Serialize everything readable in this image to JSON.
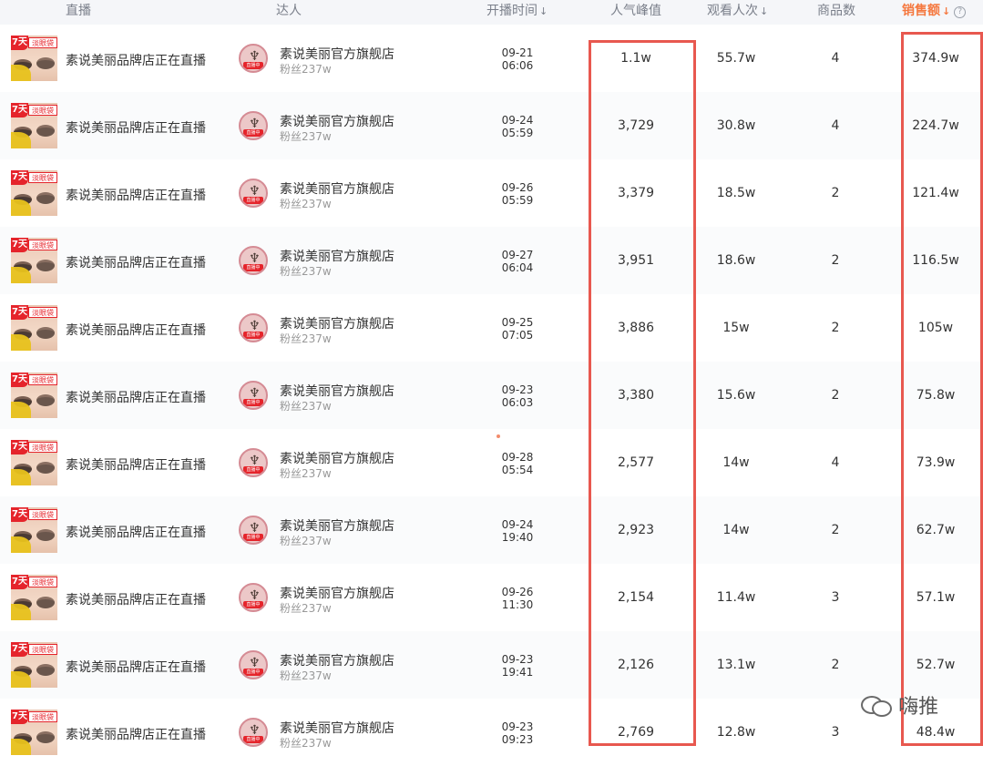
{
  "header": {
    "live": "直播",
    "anchor": "达人",
    "start_time": "开播时间",
    "peak": "人气峰值",
    "views": "观看人次",
    "goods": "商品数",
    "sales": "销售额",
    "sort_arrow": "↓",
    "help": "?"
  },
  "thumb": {
    "badge_day": "7天",
    "badge_text": "淡眼袋"
  },
  "avatar": {
    "crane": "♆",
    "live_tag": "直播中"
  },
  "rows": [
    {
      "title": "素说美丽品牌店正在直播",
      "anchor": "素说美丽官方旗舰店",
      "fans": "粉丝237w",
      "date": "09-21",
      "time": "06:06",
      "peak": "1.1w",
      "views": "55.7w",
      "goods": "4",
      "sales": "374.9w"
    },
    {
      "title": "素说美丽品牌店正在直播",
      "anchor": "素说美丽官方旗舰店",
      "fans": "粉丝237w",
      "date": "09-24",
      "time": "05:59",
      "peak": "3,729",
      "views": "30.8w",
      "goods": "4",
      "sales": "224.7w"
    },
    {
      "title": "素说美丽品牌店正在直播",
      "anchor": "素说美丽官方旗舰店",
      "fans": "粉丝237w",
      "date": "09-26",
      "time": "05:59",
      "peak": "3,379",
      "views": "18.5w",
      "goods": "2",
      "sales": "121.4w"
    },
    {
      "title": "素说美丽品牌店正在直播",
      "anchor": "素说美丽官方旗舰店",
      "fans": "粉丝237w",
      "date": "09-27",
      "time": "06:04",
      "peak": "3,951",
      "views": "18.6w",
      "goods": "2",
      "sales": "116.5w"
    },
    {
      "title": "素说美丽品牌店正在直播",
      "anchor": "素说美丽官方旗舰店",
      "fans": "粉丝237w",
      "date": "09-25",
      "time": "07:05",
      "peak": "3,886",
      "views": "15w",
      "goods": "2",
      "sales": "105w"
    },
    {
      "title": "素说美丽品牌店正在直播",
      "anchor": "素说美丽官方旗舰店",
      "fans": "粉丝237w",
      "date": "09-23",
      "time": "06:03",
      "peak": "3,380",
      "views": "15.6w",
      "goods": "2",
      "sales": "75.8w"
    },
    {
      "title": "素说美丽品牌店正在直播",
      "anchor": "素说美丽官方旗舰店",
      "fans": "粉丝237w",
      "date": "09-28",
      "time": "05:54",
      "peak": "2,577",
      "views": "14w",
      "goods": "4",
      "sales": "73.9w"
    },
    {
      "title": "素说美丽品牌店正在直播",
      "anchor": "素说美丽官方旗舰店",
      "fans": "粉丝237w",
      "date": "09-24",
      "time": "19:40",
      "peak": "2,923",
      "views": "14w",
      "goods": "2",
      "sales": "62.7w"
    },
    {
      "title": "素说美丽品牌店正在直播",
      "anchor": "素说美丽官方旗舰店",
      "fans": "粉丝237w",
      "date": "09-26",
      "time": "11:30",
      "peak": "2,154",
      "views": "11.4w",
      "goods": "3",
      "sales": "57.1w"
    },
    {
      "title": "素说美丽品牌店正在直播",
      "anchor": "素说美丽官方旗舰店",
      "fans": "粉丝237w",
      "date": "09-23",
      "time": "19:41",
      "peak": "2,126",
      "views": "13.1w",
      "goods": "2",
      "sales": "52.7w"
    },
    {
      "title": "素说美丽品牌店正在直播",
      "anchor": "素说美丽官方旗舰店",
      "fans": "粉丝237w",
      "date": "09-23",
      "time": "09:23",
      "peak": "2,769",
      "views": "12.8w",
      "goods": "3",
      "sales": "48.4w"
    }
  ],
  "watermark": {
    "text": "嗨推"
  },
  "colors": {
    "accent": "#f5783f",
    "highlight_box": "#e8584f",
    "header_bg": "#f5f6f9"
  }
}
